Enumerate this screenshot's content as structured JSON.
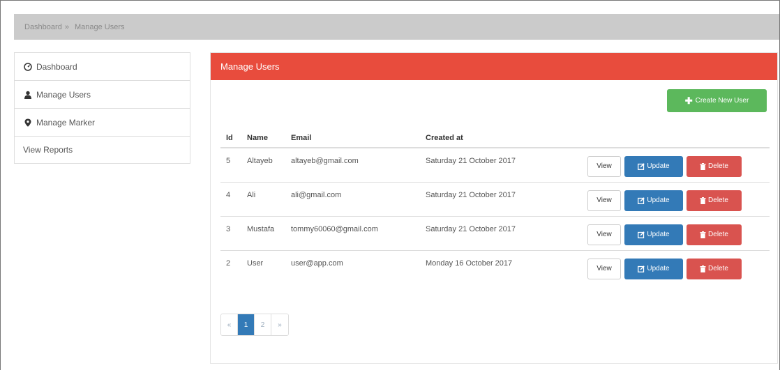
{
  "breadcrumb": {
    "items": [
      "Dashboard",
      "Manage Users"
    ],
    "separator": "»"
  },
  "sidebar": {
    "items": [
      {
        "label": "Dashboard",
        "icon": "dashboard-icon"
      },
      {
        "label": "Manage Users",
        "icon": "user-icon"
      },
      {
        "label": "Manage Marker",
        "icon": "map-marker-icon"
      },
      {
        "label": "View Reports",
        "icon": ""
      }
    ]
  },
  "panel": {
    "title": "Manage Users",
    "create_label": "Create New User"
  },
  "table": {
    "headers": [
      "Id",
      "Name",
      "Email",
      "Created at"
    ],
    "rows": [
      {
        "id": "5",
        "name": "Altayeb",
        "email": "altayeb@gmail.com",
        "created": "Saturday 21 October 2017"
      },
      {
        "id": "4",
        "name": "Ali",
        "email": "ali@gmail.com",
        "created": "Saturday 21 October 2017"
      },
      {
        "id": "3",
        "name": "Mustafa",
        "email": "tommy60060@gmail.com",
        "created": "Saturday 21 October 2017"
      },
      {
        "id": "2",
        "name": "User",
        "email": "user@app.com",
        "created": "Monday 16 October 2017"
      }
    ],
    "action_labels": {
      "view": "View",
      "update": "Update",
      "delete": "Delete"
    }
  },
  "pagination": {
    "prev": "«",
    "pages": [
      "1",
      "2"
    ],
    "next": "»",
    "active": "1"
  },
  "colors": {
    "header_red": "#e84c3d",
    "create_green": "#5cb85c",
    "update_blue": "#337ab7",
    "delete_red": "#d9534f",
    "breadcrumb_gray": "#cbcbcb"
  }
}
